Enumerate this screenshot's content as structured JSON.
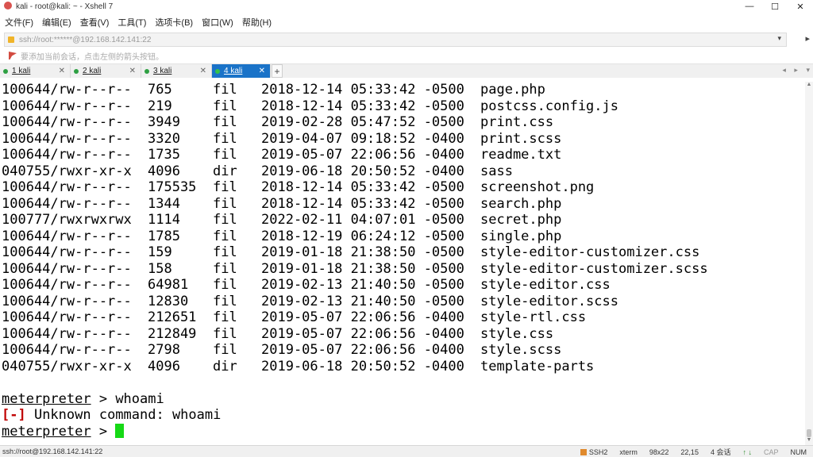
{
  "window": {
    "title": "kali - root@kali: ~ - Xshell 7",
    "controls": [
      "—",
      "☐",
      "✕"
    ]
  },
  "menu": [
    "文件(F)",
    "编辑(E)",
    "查看(V)",
    "工具(T)",
    "选项卡(B)",
    "窗口(W)",
    "帮助(H)"
  ],
  "address": {
    "value": "ssh://root:******@192.168.142.141:22",
    "dropdown": "▾",
    "side": "▸"
  },
  "hint": "要添加当前会话，点击左侧的箭头按钮。",
  "tabs": [
    {
      "label": "1 kali",
      "close": "✕"
    },
    {
      "label": "2 kali",
      "close": "✕"
    },
    {
      "label": "3 kali",
      "close": "✕"
    },
    {
      "label": "4 kali",
      "close": "✕",
      "active": true
    }
  ],
  "tab_add": "+",
  "tab_nav": [
    "◂",
    "▸",
    "▾"
  ],
  "terminal": {
    "listing": [
      {
        "mode": "100644/rw-r--r--",
        "size": "765",
        "type": "fil",
        "date": "2018-12-14 05:33:42 -0500",
        "name": "page.php"
      },
      {
        "mode": "100644/rw-r--r--",
        "size": "219",
        "type": "fil",
        "date": "2018-12-14 05:33:42 -0500",
        "name": "postcss.config.js"
      },
      {
        "mode": "100644/rw-r--r--",
        "size": "3949",
        "type": "fil",
        "date": "2019-02-28 05:47:52 -0500",
        "name": "print.css"
      },
      {
        "mode": "100644/rw-r--r--",
        "size": "3320",
        "type": "fil",
        "date": "2019-04-07 09:18:52 -0400",
        "name": "print.scss"
      },
      {
        "mode": "100644/rw-r--r--",
        "size": "1735",
        "type": "fil",
        "date": "2019-05-07 22:06:56 -0400",
        "name": "readme.txt"
      },
      {
        "mode": "040755/rwxr-xr-x",
        "size": "4096",
        "type": "dir",
        "date": "2019-06-18 20:50:52 -0400",
        "name": "sass"
      },
      {
        "mode": "100644/rw-r--r--",
        "size": "175535",
        "type": "fil",
        "date": "2018-12-14 05:33:42 -0500",
        "name": "screenshot.png"
      },
      {
        "mode": "100644/rw-r--r--",
        "size": "1344",
        "type": "fil",
        "date": "2018-12-14 05:33:42 -0500",
        "name": "search.php"
      },
      {
        "mode": "100777/rwxrwxrwx",
        "size": "1114",
        "type": "fil",
        "date": "2022-02-11 04:07:01 -0500",
        "name": "secret.php"
      },
      {
        "mode": "100644/rw-r--r--",
        "size": "1785",
        "type": "fil",
        "date": "2018-12-19 06:24:12 -0500",
        "name": "single.php"
      },
      {
        "mode": "100644/rw-r--r--",
        "size": "159",
        "type": "fil",
        "date": "2019-01-18 21:38:50 -0500",
        "name": "style-editor-customizer.css"
      },
      {
        "mode": "100644/rw-r--r--",
        "size": "158",
        "type": "fil",
        "date": "2019-01-18 21:38:50 -0500",
        "name": "style-editor-customizer.scss"
      },
      {
        "mode": "100644/rw-r--r--",
        "size": "64981",
        "type": "fil",
        "date": "2019-02-13 21:40:50 -0500",
        "name": "style-editor.css"
      },
      {
        "mode": "100644/rw-r--r--",
        "size": "12830",
        "type": "fil",
        "date": "2019-02-13 21:40:50 -0500",
        "name": "style-editor.scss"
      },
      {
        "mode": "100644/rw-r--r--",
        "size": "212651",
        "type": "fil",
        "date": "2019-05-07 22:06:56 -0400",
        "name": "style-rtl.css"
      },
      {
        "mode": "100644/rw-r--r--",
        "size": "212849",
        "type": "fil",
        "date": "2019-05-07 22:06:56 -0400",
        "name": "style.css"
      },
      {
        "mode": "100644/rw-r--r--",
        "size": "2798",
        "type": "fil",
        "date": "2019-05-07 22:06:56 -0400",
        "name": "style.scss"
      },
      {
        "mode": "040755/rwxr-xr-x",
        "size": "4096",
        "type": "dir",
        "date": "2019-06-18 20:50:52 -0400",
        "name": "template-parts"
      }
    ],
    "prompt": "meterpreter",
    "prompt_sep": " > ",
    "command": "whoami",
    "error_tag": "[-]",
    "error_text": " Unknown command: whoami"
  },
  "status": {
    "connection": "ssh://root@192.168.142.141:22",
    "protocol": "SSH2",
    "term": "xterm",
    "size": "98x22",
    "cursor": "22,15",
    "sessions": "4 会话",
    "arrows": "↑ ↓",
    "cap": "CAP",
    "num": "NUM"
  },
  "colors": {
    "active_tab": "#1a73c8",
    "cursor": "#16d916",
    "error": "#c00000"
  }
}
